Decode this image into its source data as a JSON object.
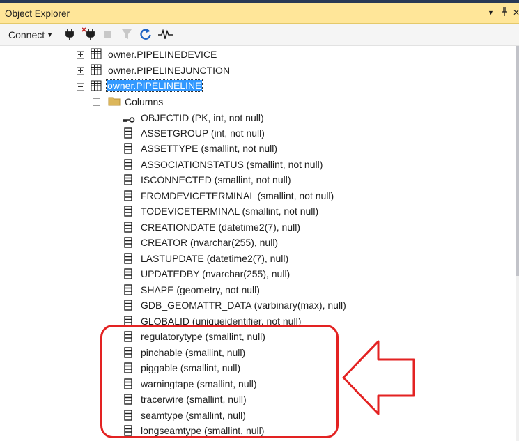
{
  "window": {
    "title": "Object Explorer",
    "controls": {
      "dropdown": "▼",
      "pin": "📌",
      "close": "✕"
    }
  },
  "toolbar": {
    "connect_label": "Connect",
    "tools": [
      "connect-plug-icon",
      "disconnect-icon",
      "stop-icon",
      "filter-icon",
      "refresh-icon",
      "activity-monitor-icon"
    ]
  },
  "tree": {
    "tables": [
      {
        "label": "owner.PIPELINEDEVICE",
        "expanded": false,
        "selected": false
      },
      {
        "label": "owner.PIPELINEJUNCTION",
        "expanded": false,
        "selected": false
      },
      {
        "label": "owner.PIPELINELINE",
        "expanded": true,
        "selected": true
      }
    ],
    "folder": {
      "label": "Columns",
      "expanded": true
    },
    "columns": [
      {
        "label": "OBJECTID (PK, int, not null)",
        "icon": "primary-key-icon"
      },
      {
        "label": "ASSETGROUP (int, not null)",
        "icon": "column-icon"
      },
      {
        "label": "ASSETTYPE (smallint, not null)",
        "icon": "column-icon"
      },
      {
        "label": "ASSOCIATIONSTATUS (smallint, not null)",
        "icon": "column-icon"
      },
      {
        "label": "ISCONNECTED (smallint, not null)",
        "icon": "column-icon"
      },
      {
        "label": "FROMDEVICETERMINAL (smallint, not null)",
        "icon": "column-icon"
      },
      {
        "label": "TODEVICETERMINAL (smallint, not null)",
        "icon": "column-icon"
      },
      {
        "label": "CREATIONDATE (datetime2(7), null)",
        "icon": "column-icon"
      },
      {
        "label": "CREATOR (nvarchar(255), null)",
        "icon": "column-icon"
      },
      {
        "label": "LASTUPDATE (datetime2(7), null)",
        "icon": "column-icon"
      },
      {
        "label": "UPDATEDBY (nvarchar(255), null)",
        "icon": "column-icon"
      },
      {
        "label": "SHAPE (geometry, not null)",
        "icon": "column-icon"
      },
      {
        "label": "GDB_GEOMATTR_DATA (varbinary(max), null)",
        "icon": "column-icon"
      },
      {
        "label": "GLOBALID (uniqueidentifier, not null)",
        "icon": "column-icon"
      },
      {
        "label": "regulatorytype (smallint, null)",
        "icon": "column-icon"
      },
      {
        "label": "pinchable (smallint, null)",
        "icon": "column-icon"
      },
      {
        "label": "piggable (smallint, null)",
        "icon": "column-icon"
      },
      {
        "label": "warningtape (smallint, null)",
        "icon": "column-icon"
      },
      {
        "label": "tracerwire (smallint, null)",
        "icon": "column-icon"
      },
      {
        "label": "seamtype (smallint, null)",
        "icon": "column-icon"
      },
      {
        "label": "longseamtype (smallint, null)",
        "icon": "column-icon"
      }
    ]
  },
  "annotation": {
    "color": "#e32222",
    "shape": "rounded-rectangle-with-arrow"
  }
}
